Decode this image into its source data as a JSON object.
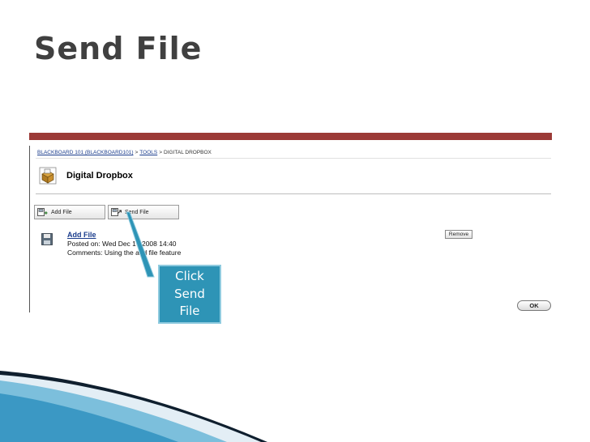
{
  "slide": {
    "title": "Send File"
  },
  "breadcrumb": {
    "course": "BLACKBOARD 101 (BLACKBOARD101)",
    "sep1": ">",
    "tools": "TOOLS",
    "sep2": ">",
    "current": "DIGITAL DROPBOX"
  },
  "page": {
    "title": "Digital Dropbox"
  },
  "toolbar": {
    "add_file_label": "Add File",
    "send_file_label": "Send File"
  },
  "file_item": {
    "name": "Add File",
    "posted": "Posted on: Wed Dec 17 2008 14:40",
    "comments": "Comments: Using the add file feature",
    "remove_label": "Remove"
  },
  "footer": {
    "ok_label": "OK"
  },
  "callout": {
    "text": "Click Send File"
  },
  "colors": {
    "header_bar": "#9b3a37",
    "callout_fill": "#2e94b6",
    "link": "#1a3c8c"
  }
}
